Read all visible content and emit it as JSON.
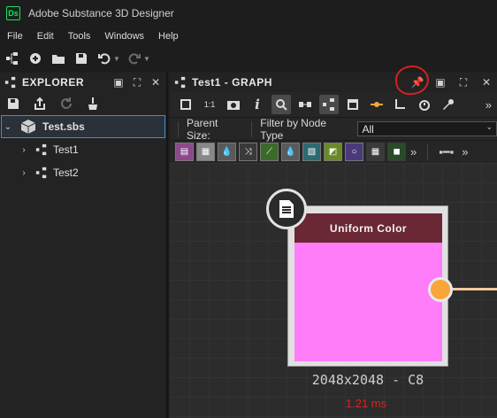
{
  "app": {
    "logo": "Ds",
    "title": "Adobe Substance 3D Designer"
  },
  "menu": [
    "File",
    "Edit",
    "Tools",
    "Windows",
    "Help"
  ],
  "explorer": {
    "title": "EXPLORER",
    "tree": [
      {
        "label": "Test.sbs",
        "selected": true,
        "expanded": true
      },
      {
        "label": "Test1"
      },
      {
        "label": "Test2"
      }
    ]
  },
  "graph": {
    "title": "Test1 - GRAPH",
    "filter": {
      "parent_size_label": "Parent Size:",
      "node_type_label": "Filter by Node Type",
      "node_type_value": "All"
    },
    "node": {
      "title": "Uniform Color",
      "resolution": "2048x2048 - C8",
      "time": "1.21 ms",
      "color": "#ff7df9"
    }
  },
  "colors": {
    "accent": "#3b8fd6",
    "annotation": "#d42222",
    "port": "#f8a53a"
  }
}
